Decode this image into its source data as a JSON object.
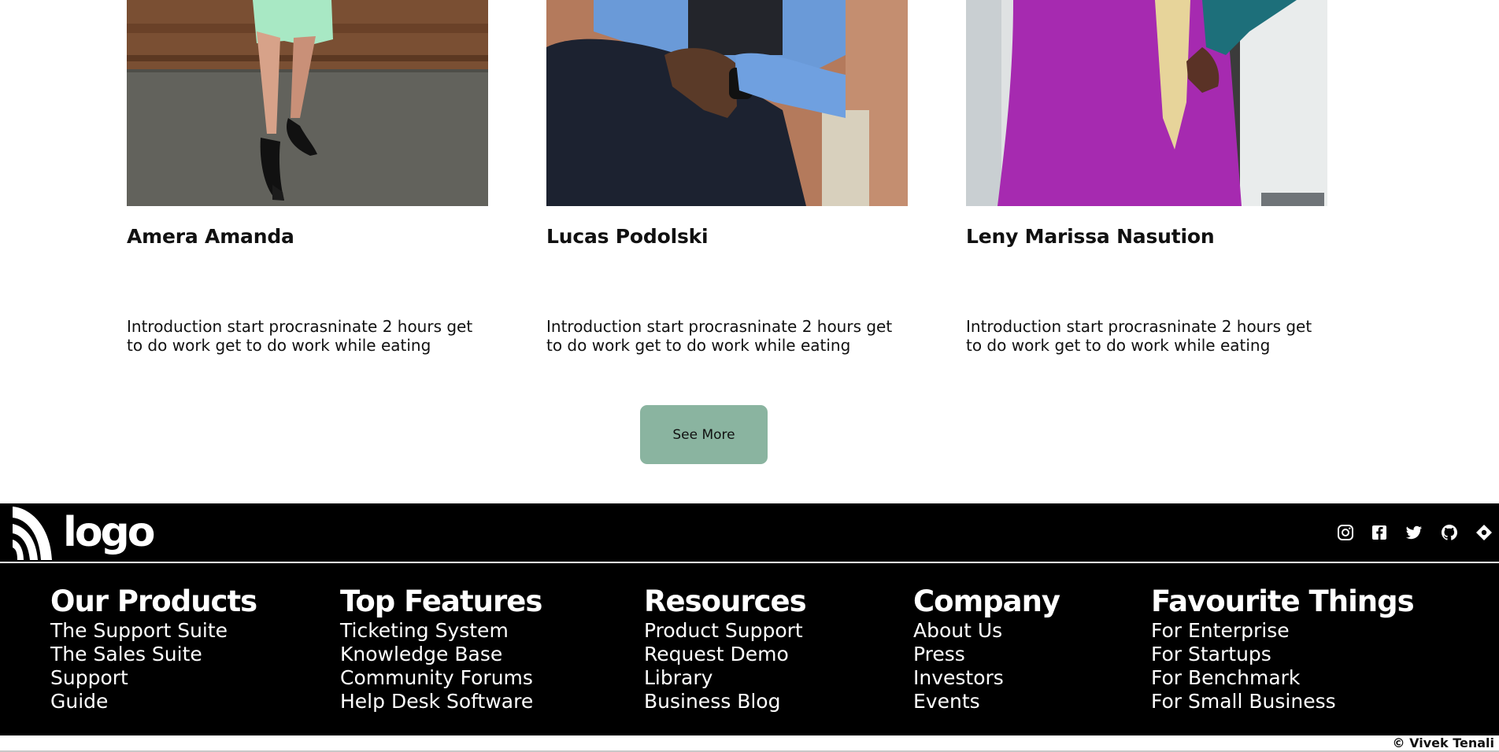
{
  "team": {
    "members": [
      {
        "name": "Amera Amanda",
        "bio": "Introduction start procrasninate 2 hours get to do work get to do work while eating"
      },
      {
        "name": "Lucas Podolski",
        "bio": "Introduction start procrasninate 2 hours get to do work get to do work while eating"
      },
      {
        "name": "Leny Marissa Nasution",
        "bio": "Introduction start procrasninate 2 hours get to do work get to do work while eating"
      }
    ],
    "see_more_label": "See More",
    "see_more_color": "#8ab4a0"
  },
  "footer": {
    "logo_text": "logo",
    "social_icons": [
      "instagram-icon",
      "facebook-icon",
      "twitter-icon",
      "github-icon",
      "diamond-icon"
    ],
    "columns": [
      {
        "heading": "Our Products",
        "links": [
          "The Support Suite",
          "The Sales Suite",
          "Support",
          "Guide"
        ]
      },
      {
        "heading": "Top Features",
        "links": [
          "Ticketing System",
          "Knowledge Base",
          "Community Forums",
          "Help Desk Software"
        ]
      },
      {
        "heading": "Resources",
        "links": [
          "Product Support",
          "Request Demo",
          "Library",
          "Business Blog"
        ]
      },
      {
        "heading": "Company",
        "links": [
          "About Us",
          "Press",
          "Investors",
          "Events"
        ]
      },
      {
        "heading": "Favourite Things",
        "links": [
          "For Enterprise",
          "For Startups",
          "For Benchmark",
          "For Small Business"
        ]
      }
    ],
    "copyright": "© Vivek Tenali"
  }
}
